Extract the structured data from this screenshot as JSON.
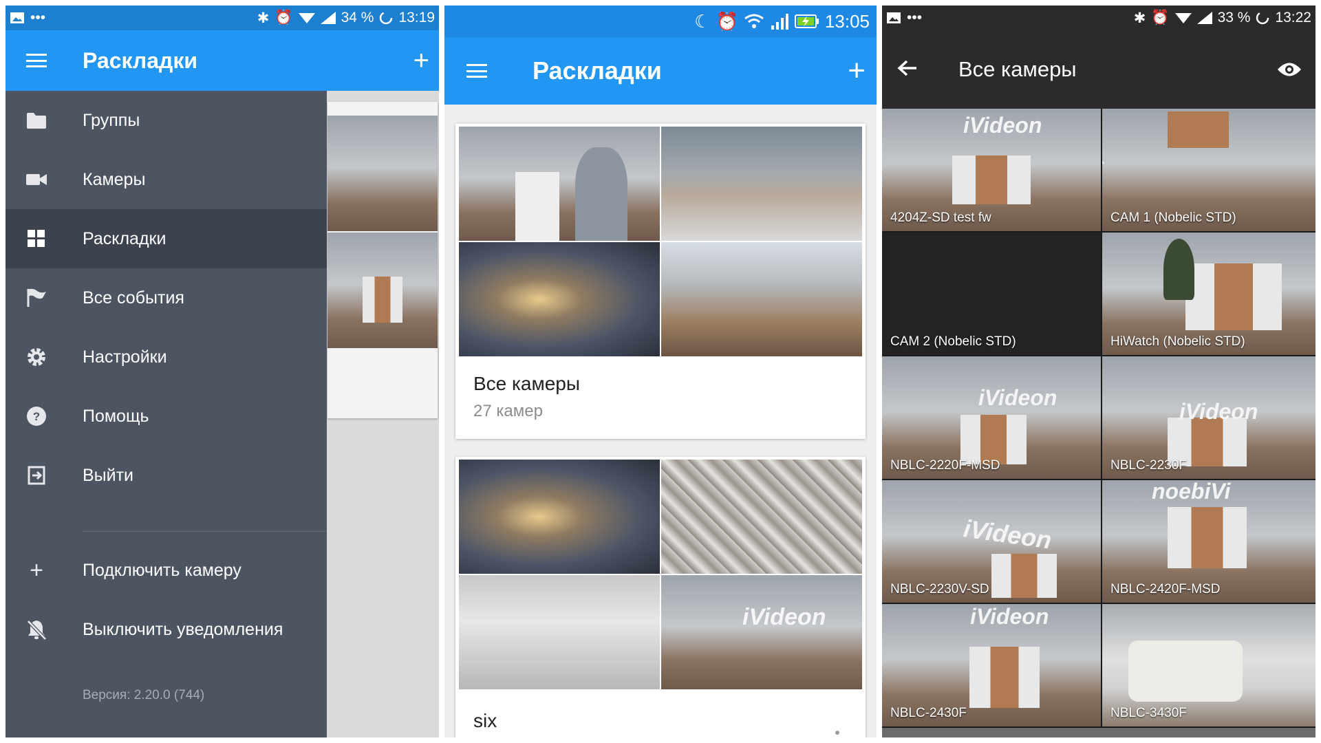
{
  "panel1": {
    "status": {
      "battery": "34 %",
      "time": "13:19"
    },
    "appbar": {
      "title": "Раскладки"
    },
    "drawer": {
      "items": [
        {
          "label": "Группы",
          "icon": "folder-icon"
        },
        {
          "label": "Камеры",
          "icon": "videocam-icon"
        },
        {
          "label": "Раскладки",
          "icon": "grid-icon",
          "active": true
        },
        {
          "label": "Все события",
          "icon": "flag-icon"
        },
        {
          "label": "Настройки",
          "icon": "gear-icon"
        },
        {
          "label": "Помощь",
          "icon": "help-icon"
        },
        {
          "label": "Выйти",
          "icon": "exit-icon"
        }
      ],
      "secondary": [
        {
          "label": "Подключить камеру",
          "icon": "plus-icon"
        },
        {
          "label": "Выключить уведомления",
          "icon": "bell-off-icon"
        }
      ],
      "version": "Версия: 2.20.0 (744)"
    }
  },
  "panel2": {
    "status": {
      "time": "13:05"
    },
    "appbar": {
      "title": "Раскладки"
    },
    "layouts": [
      {
        "name": "Все камеры",
        "count": "27 камер"
      },
      {
        "name": "six"
      }
    ],
    "overlay_logo": "iVideon"
  },
  "panel3": {
    "status": {
      "battery": "33 %",
      "time": "13:22"
    },
    "appbar": {
      "title": "Все камеры"
    },
    "cameras": [
      "4204Z-SD test fw",
      "CAM 1 (Nobelic STD)",
      "CAM 2 (Nobelic STD)",
      "HiWatch (Nobelic STD)",
      "NBLC-2220F-MSD",
      "NBLC-2230F",
      "NBLC-2230V-SD",
      "NBLC-2420F-MSD",
      "NBLC-2430F",
      "NBLC-3430F"
    ],
    "logos": {
      "normal": "iVideon",
      "mirrored": "noebiVi",
      "vertical": "iVid"
    }
  },
  "colors": {
    "primary": "#2196f3",
    "drawer": "#4d5563",
    "drawer_active": "#3c434f"
  }
}
